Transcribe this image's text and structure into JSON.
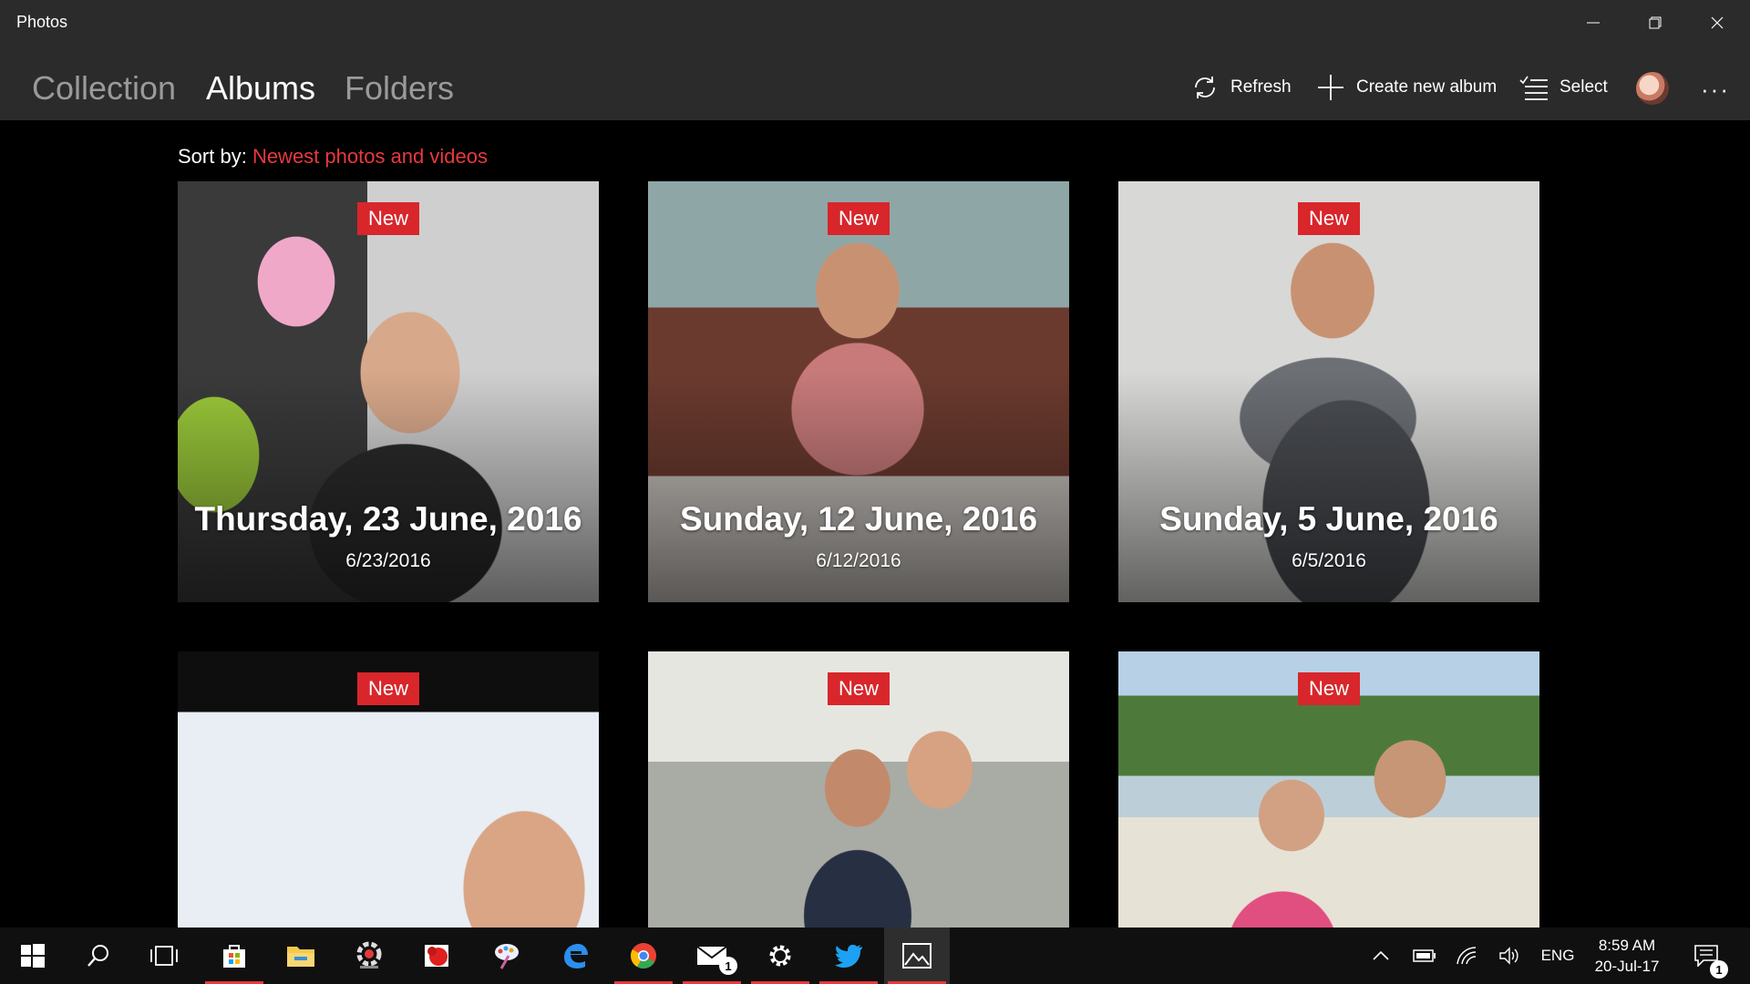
{
  "window": {
    "title": "Photos"
  },
  "nav": {
    "tabs": [
      {
        "label": "Collection",
        "active": false
      },
      {
        "label": "Albums",
        "active": true
      },
      {
        "label": "Folders",
        "active": false
      }
    ],
    "commands": {
      "refresh": "Refresh",
      "create_album": "Create new album",
      "select": "Select"
    },
    "more": "···"
  },
  "sort": {
    "label": "Sort by:",
    "value": "Newest photos and videos"
  },
  "accent_color": "#e8393e",
  "badge_color": "#d8262b",
  "albums": [
    {
      "badge": "New",
      "title": "Thursday, 23 June, 2016",
      "date": "6/23/2016"
    },
    {
      "badge": "New",
      "title": "Sunday, 12 June, 2016",
      "date": "6/12/2016"
    },
    {
      "badge": "New",
      "title": "Sunday, 5 June, 2016",
      "date": "6/5/2016"
    },
    {
      "badge": "New",
      "title": "",
      "date": ""
    },
    {
      "badge": "New",
      "title": "",
      "date": ""
    },
    {
      "badge": "New",
      "title": "",
      "date": ""
    }
  ],
  "taskbar": {
    "apps": [
      {
        "name": "start-icon"
      },
      {
        "name": "search-icon"
      },
      {
        "name": "task-view-icon"
      },
      {
        "name": "store-icon"
      },
      {
        "name": "file-explorer-icon"
      },
      {
        "name": "photoscape-icon"
      },
      {
        "name": "red-app-icon"
      },
      {
        "name": "paint-app-icon"
      },
      {
        "name": "edge-icon"
      },
      {
        "name": "chrome-icon"
      },
      {
        "name": "mail-icon",
        "badge": "1"
      },
      {
        "name": "settings-icon"
      },
      {
        "name": "twitter-icon"
      },
      {
        "name": "photos-icon"
      }
    ],
    "tray": {
      "language": "ENG",
      "time": "8:59 AM",
      "date": "20-Jul-17",
      "notifications": "1"
    }
  }
}
